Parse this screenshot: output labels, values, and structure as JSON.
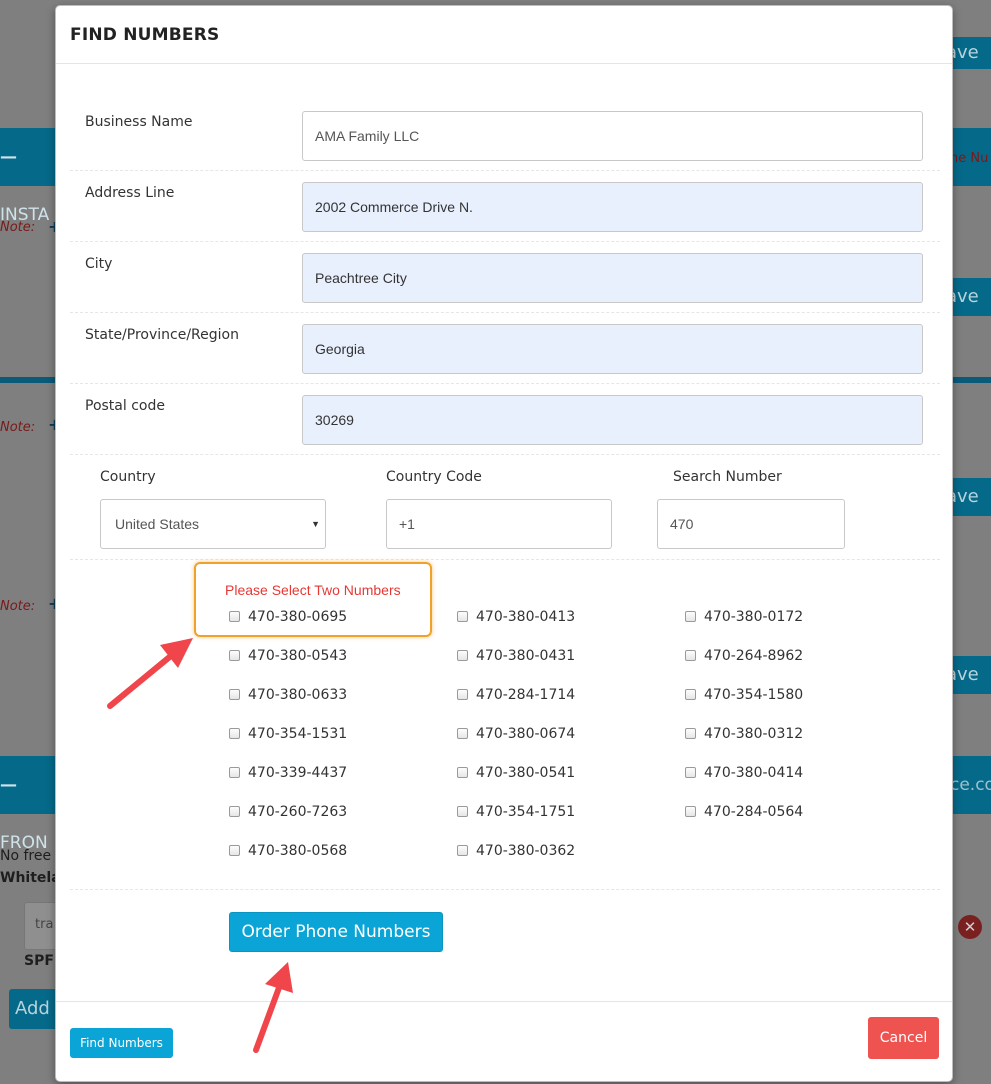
{
  "background": {
    "bar1": "INSTA",
    "bar2": "FRON",
    "bar_right_1": "ne Nu",
    "bar_right_2": "ce.co",
    "save": "ave",
    "note": "Note:",
    "no_free": "No free e",
    "whitelab": "Whitelab",
    "input_text": "tra",
    "spf": "SPF",
    "add": "Add"
  },
  "modal": {
    "title": "FIND NUMBERS",
    "fields": [
      {
        "label": "Business Name",
        "value": "AMA Family LLC"
      },
      {
        "label": "Address Line",
        "value": "2002 Commerce Drive N."
      },
      {
        "label": "City",
        "value": "Peachtree City"
      },
      {
        "label": "State/Province/Region",
        "value": "Georgia"
      },
      {
        "label": "Postal code",
        "value": "30269"
      }
    ],
    "country": {
      "label": "Country",
      "value": "United States"
    },
    "country_code": {
      "label": "Country Code",
      "value": "+1"
    },
    "search_number": {
      "label": "Search Number",
      "value": "470"
    },
    "warning": "Please Select Two Numbers",
    "numbers": [
      "470-380-0695",
      "470-380-0413",
      "470-380-0172",
      "470-380-0543",
      "470-380-0431",
      "470-264-8962",
      "470-380-0633",
      "470-284-1714",
      "470-354-1580",
      "470-354-1531",
      "470-380-0674",
      "470-380-0312",
      "470-339-4437",
      "470-380-0541",
      "470-380-0414",
      "470-260-7263",
      "470-354-1751",
      "470-284-0564",
      "470-380-0568",
      "470-380-0362"
    ],
    "order_button": "Order Phone Numbers",
    "find_button": "Find Numbers",
    "cancel_button": "Cancel"
  },
  "colors": {
    "accent": "#0aa5d6",
    "danger": "#ee5350",
    "warning_text": "#e53935",
    "highlight": "#f0a12c",
    "arrow": "#f0454a"
  }
}
